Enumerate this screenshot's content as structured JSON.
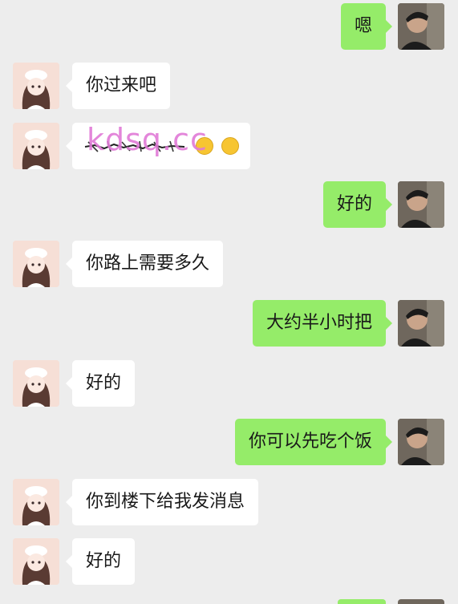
{
  "watermark": "kdsq.cc",
  "messages": [
    {
      "side": "right",
      "text": "嗯"
    },
    {
      "side": "left",
      "text": "你过来吧"
    },
    {
      "side": "left",
      "text": "",
      "redacted": true,
      "emojis": [
        "grin-face-icon",
        "thinking-face-icon"
      ]
    },
    {
      "side": "right",
      "text": "好的"
    },
    {
      "side": "left",
      "text": "你路上需要多久"
    },
    {
      "side": "right",
      "text": "大约半小时把"
    },
    {
      "side": "left",
      "text": "好的"
    },
    {
      "side": "right",
      "text": "你可以先吃个饭"
    },
    {
      "side": "left",
      "text": "你到楼下给我发消息"
    },
    {
      "side": "left",
      "text": "好的"
    }
  ],
  "colors": {
    "background": "#ededed",
    "self_bubble": "#95ec69",
    "other_bubble": "#ffffff",
    "watermark": "#e07ad6"
  }
}
